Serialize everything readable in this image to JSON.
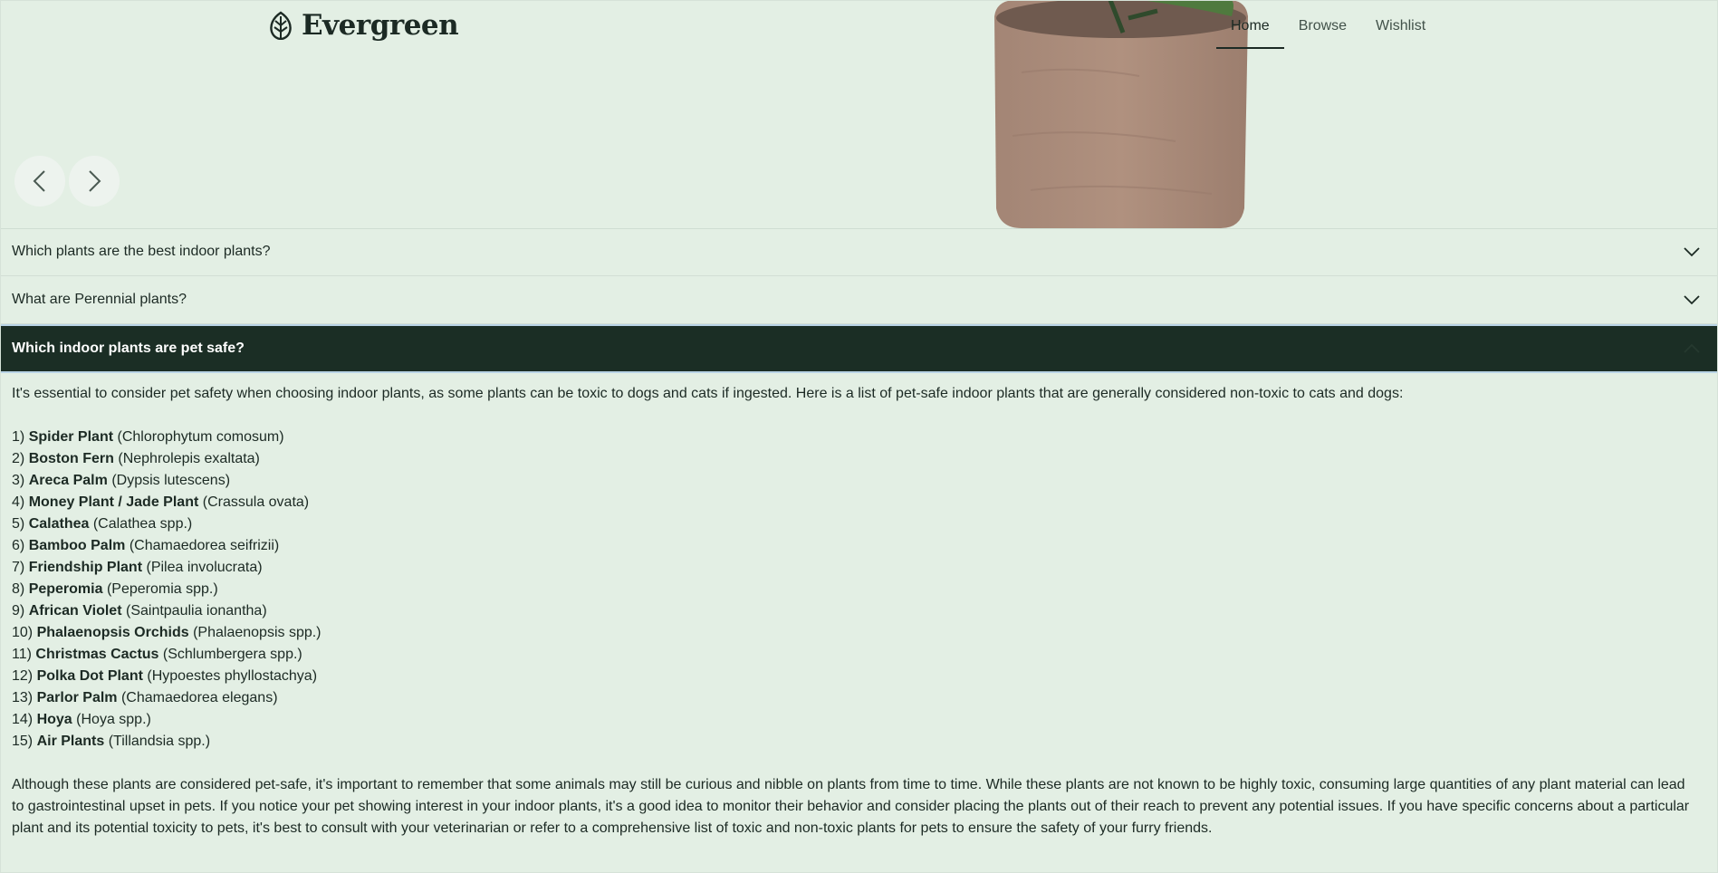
{
  "header": {
    "brand": "Evergreen",
    "nav": [
      {
        "label": "Home",
        "active": true
      },
      {
        "label": "Browse",
        "active": false
      },
      {
        "label": "Wishlist",
        "active": false
      }
    ]
  },
  "carousel": {
    "prev_icon": "chevron-left-icon",
    "next_icon": "chevron-right-icon"
  },
  "faq": {
    "items": [
      {
        "question": "Which plants are the best indoor plants?",
        "open": false
      },
      {
        "question": "What are Perennial plants?",
        "open": false
      },
      {
        "question": "Which indoor plants are pet safe?",
        "open": true
      }
    ],
    "answer": {
      "intro": "It's essential to consider pet safety when choosing indoor plants, as some plants can be toxic to dogs and cats if ingested. Here is a list of pet-safe indoor plants that are generally considered non-toxic to cats and dogs:",
      "plants": [
        {
          "num": "1)",
          "name": "Spider Plant",
          "sci": "(Chlorophytum comosum)"
        },
        {
          "num": "2)",
          "name": "Boston Fern",
          "sci": "(Nephrolepis exaltata)"
        },
        {
          "num": "3)",
          "name": "Areca Palm",
          "sci": "(Dypsis lutescens)"
        },
        {
          "num": "4)",
          "name": "Money Plant / Jade Plant",
          "sci": "(Crassula ovata)"
        },
        {
          "num": "5)",
          "name": "Calathea",
          "sci": "(Calathea spp.)"
        },
        {
          "num": "6)",
          "name": "Bamboo Palm",
          "sci": "(Chamaedorea seifrizii)"
        },
        {
          "num": "7)",
          "name": "Friendship Plant",
          "sci": "(Pilea involucrata)"
        },
        {
          "num": "8)",
          "name": "Peperomia",
          "sci": "(Peperomia spp.)"
        },
        {
          "num": "9)",
          "name": "African Violet",
          "sci": "(Saintpaulia ionantha)"
        },
        {
          "num": "10)",
          "name": "Phalaenopsis Orchids",
          "sci": "(Phalaenopsis spp.)"
        },
        {
          "num": "11)",
          "name": "Christmas Cactus",
          "sci": "(Schlumbergera spp.)"
        },
        {
          "num": "12)",
          "name": "Polka Dot Plant",
          "sci": "(Hypoestes phyllostachya)"
        },
        {
          "num": "13)",
          "name": "Parlor Palm",
          "sci": "(Chamaedorea elegans)"
        },
        {
          "num": "14)",
          "name": "Hoya",
          "sci": "(Hoya spp.)"
        },
        {
          "num": "15)",
          "name": "Air Plants",
          "sci": "(Tillandsia spp.)"
        }
      ],
      "outro": "Although these plants are considered pet-safe, it's important to remember that some animals may still be curious and nibble on plants from time to time. While these plants are not known to be highly toxic, consuming large quantities of any plant material can lead to gastrointestinal upset in pets. If you notice your pet showing interest in your indoor plants, it's a good idea to monitor their behavior and consider placing the plants out of their reach to prevent any potential issues. If you have specific concerns about a particular plant and its potential toxicity to pets, it's best to consult with your veterinarian or refer to a comprehensive list of toxic and non-toxic plants for pets to ensure the safety of your furry friends."
    }
  },
  "colors": {
    "background": "#e3efe4",
    "dark_green": "#1b2e25",
    "pot": "#a88a7a",
    "focus_outline": "#b9d4e6"
  }
}
